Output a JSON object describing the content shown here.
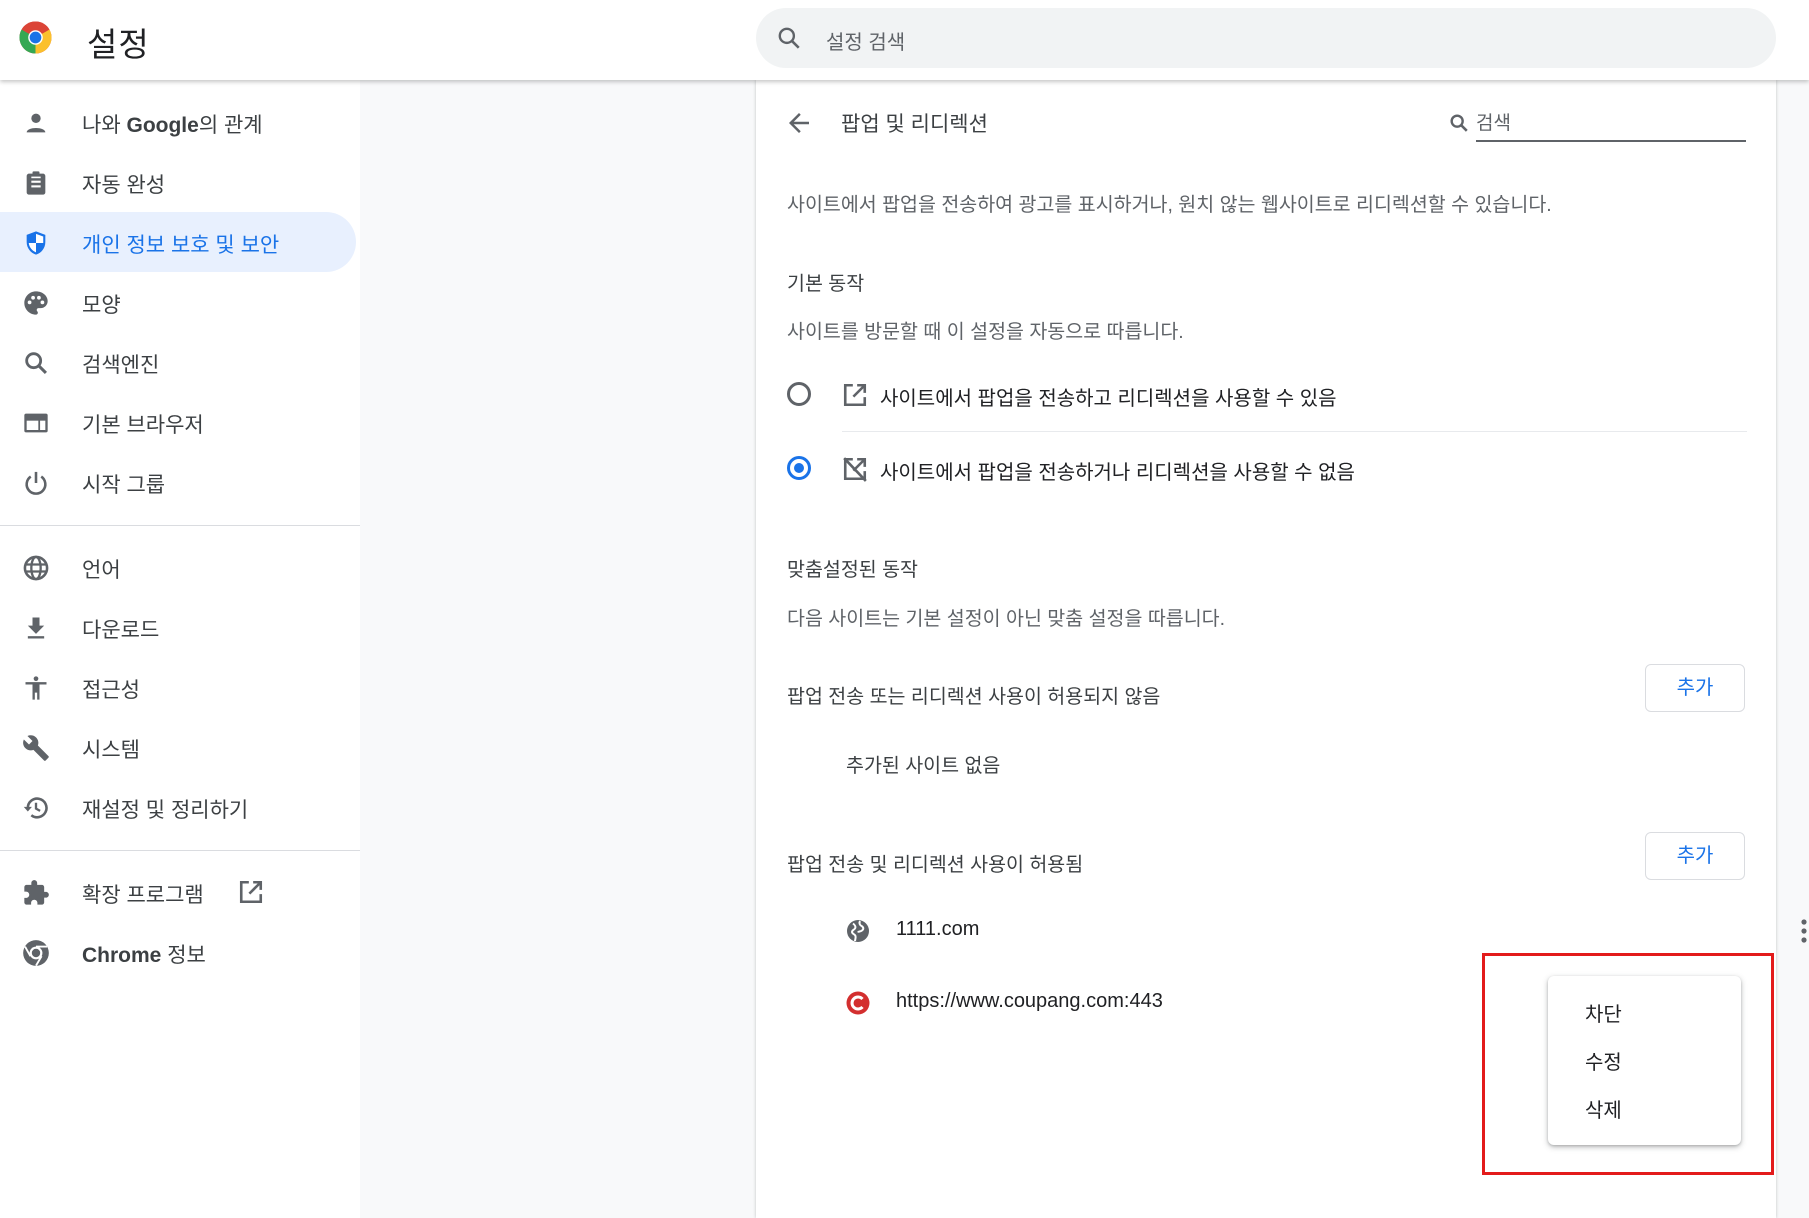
{
  "header": {
    "title": "설정",
    "search_placeholder": "설정 검색"
  },
  "sidebar": {
    "items": [
      {
        "label_pre": "나와 ",
        "label_bold": "Google",
        "label_post": "의 관계",
        "icon": "person-icon"
      },
      {
        "label": "자동 완성",
        "icon": "clipboard-icon"
      },
      {
        "label": "개인 정보 보호 및 보안",
        "icon": "shield-icon",
        "active": true
      },
      {
        "label": "모양",
        "icon": "palette-icon"
      },
      {
        "label": "검색엔진",
        "icon": "search-icon"
      },
      {
        "label": "기본 브라우저",
        "icon": "browser-window-icon"
      },
      {
        "label": "시작 그룹",
        "icon": "power-icon"
      },
      {
        "label": "언어",
        "icon": "globe-icon"
      },
      {
        "label": "다운로드",
        "icon": "download-icon"
      },
      {
        "label": "접근성",
        "icon": "accessibility-icon"
      },
      {
        "label": "시스템",
        "icon": "wrench-icon"
      },
      {
        "label": "재설정 및 정리하기",
        "icon": "history-reset-icon"
      },
      {
        "label": "확장 프로그램",
        "icon": "puzzle-icon",
        "external": true
      },
      {
        "label_bold": "Chrome",
        "label_post": " 정보",
        "icon": "chrome-icon"
      }
    ]
  },
  "page": {
    "title": "팝업 및 리디렉션",
    "search_placeholder": "검색",
    "description": "사이트에서 팝업을 전송하여 광고를 표시하거나, 원치 않는 웹사이트로 리디렉션할 수 있습니다.",
    "default_behavior": {
      "heading": "기본 동작",
      "subheading": "사이트를 방문할 때 이 설정을 자동으로 따릅니다.",
      "options": [
        {
          "label": "사이트에서 팝업을 전송하고 리디렉션을 사용할 수 있음",
          "icon": "open-in-new-icon",
          "selected": false
        },
        {
          "label": "사이트에서 팝업을 전송하거나 리디렉션을 사용할 수 없음",
          "icon": "popup-blocked-icon",
          "selected": true
        }
      ]
    },
    "custom_behavior": {
      "heading": "맞춤설정된 동작",
      "subheading": "다음 사이트는 기본 설정이 아닌 맞춤 설정을 따릅니다.",
      "blocked": {
        "label": "팝업 전송 또는 리디렉션 사용이 허용되지 않음",
        "add_label": "추가",
        "empty_text": "추가된 사이트 없음"
      },
      "allowed": {
        "label": "팝업 전송 및 리디렉션 사용이 허용됨",
        "add_label": "추가",
        "sites": [
          {
            "name": "1111.com",
            "icon": "globe-favicon"
          },
          {
            "name": "https://www.coupang.com:443",
            "icon": "coupang-favicon"
          }
        ]
      }
    }
  },
  "context_menu": {
    "items": [
      "차단",
      "수정",
      "삭제"
    ]
  },
  "colors": {
    "accent": "#1a73e8",
    "active_bg": "#e8f0fe",
    "highlight": "#e31b1b"
  }
}
